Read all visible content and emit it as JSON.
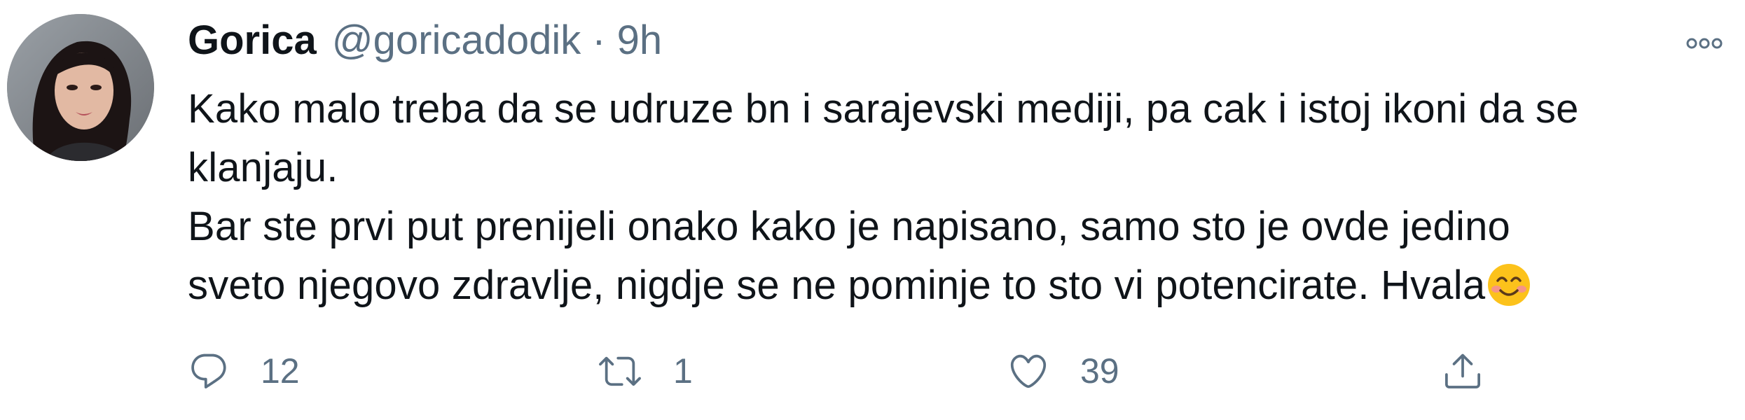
{
  "tweet": {
    "author": {
      "display_name": "Gorica",
      "handle": "@goricadodik",
      "separator": "·",
      "time": "9h"
    },
    "text_lines": [
      "Kako malo treba da se udruze bn i sarajevski mediji, pa cak i istoj ikoni da se",
      "klanjaju.",
      "Bar ste prvi put prenijeli onako kako je napisano, samo sto je ovde jedino",
      "sveto njegovo zdravlje, nigdje se ne pominje to sto vi potencirate. Hvala"
    ],
    "emoji": "smiling-face-with-smiling-eyes",
    "actions": {
      "reply_count": "12",
      "retweet_count": "1",
      "like_count": "39"
    },
    "icons": {
      "reply": "reply-icon",
      "retweet": "retweet-icon",
      "like": "heart-icon",
      "share": "share-icon",
      "more": "more-options-icon"
    },
    "colors": {
      "text_primary": "#0f1419",
      "text_secondary": "#5b7083",
      "background": "#ffffff"
    }
  }
}
